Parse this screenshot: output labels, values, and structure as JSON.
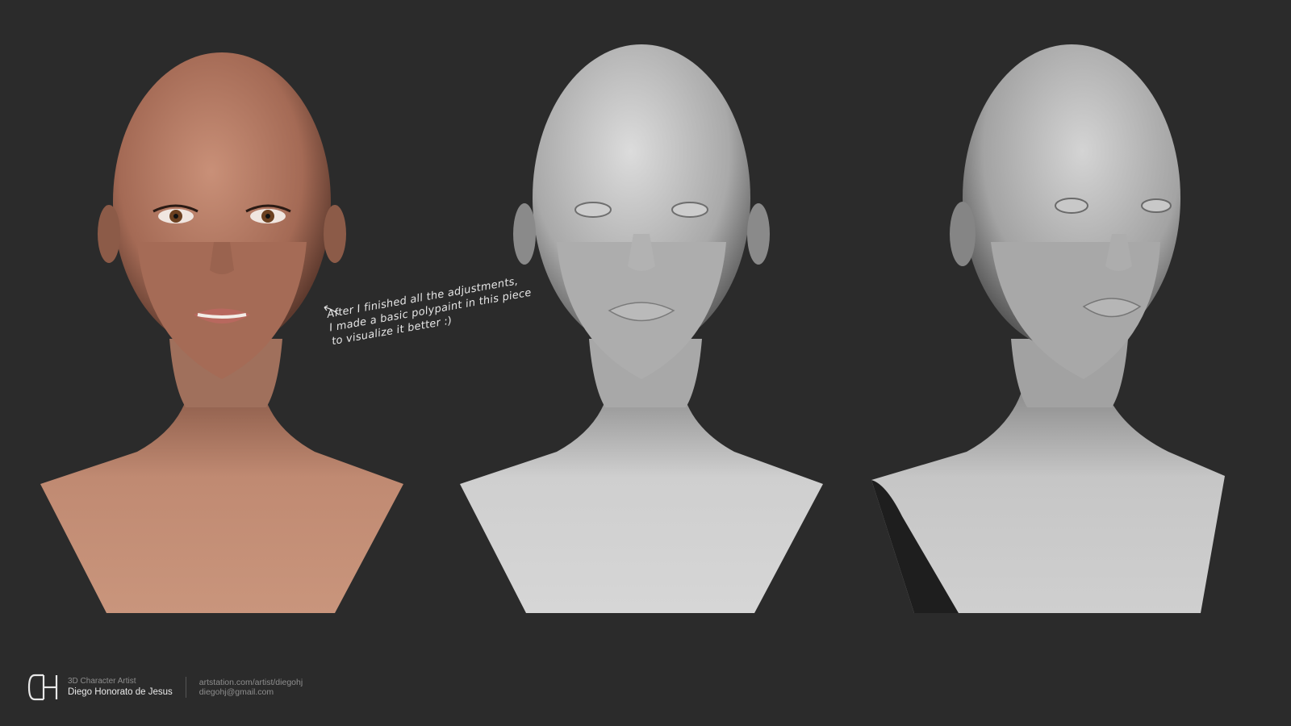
{
  "annotation": {
    "lines": [
      "After I finished all the adjustments,",
      "I made a basic polypaint in this piece",
      "to visualize it better :)"
    ]
  },
  "footer": {
    "logo_icon": "dh-monogram-icon",
    "role": "3D Character Artist",
    "name": "Diego Honorato de Jesus",
    "website": "artstation.com/artist/diegohj",
    "email": "diegohj@gmail.com"
  },
  "colors": {
    "background": "#2b2b2b",
    "skin": "#b9826a",
    "clay": "#c9c9c9"
  },
  "renders": [
    {
      "id": "polypaint-front",
      "material": "skin"
    },
    {
      "id": "clay-front",
      "material": "clay"
    },
    {
      "id": "clay-three-quarter",
      "material": "clay"
    }
  ]
}
